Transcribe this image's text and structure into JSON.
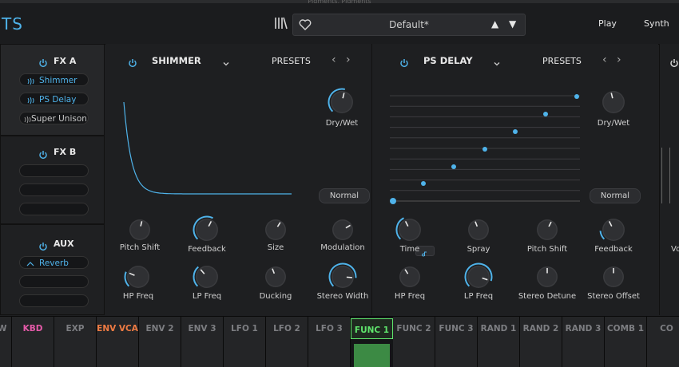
{
  "window_title": "Pigments, Pigments",
  "logo_text": "TS",
  "preset": {
    "name": "Default*",
    "up": "▲",
    "down": "▼"
  },
  "top_buttons": {
    "play": "Play",
    "synth": "Synth"
  },
  "fx_a": {
    "title": "FX A",
    "slots": [
      {
        "label": "Shimmer",
        "active": true
      },
      {
        "label": "PS Delay",
        "active": true
      },
      {
        "label": "Super Unison",
        "active": false
      }
    ]
  },
  "fx_b": {
    "title": "FX B"
  },
  "aux": {
    "title": "AUX",
    "slot": "Reverb"
  },
  "shimmer": {
    "title": "SHIMMER",
    "presets": "PRESETS",
    "prev": "‹",
    "next": "›",
    "mode": "Normal",
    "knobs": [
      "Dry/Wet",
      "Pitch Shift",
      "Feedback",
      "Size",
      "Modulation",
      "HP Freq",
      "LP Freq",
      "Ducking",
      "Stereo Width"
    ]
  },
  "ps_delay": {
    "title": "PS DELAY",
    "presets": "PRESETS",
    "prev": "‹",
    "next": "›",
    "mode": "Normal",
    "knobs": [
      "Dry/Wet",
      "Time",
      "Spray",
      "Pitch Shift",
      "Feedback",
      "HP Freq",
      "LP Freq",
      "Stereo Detune",
      "Stereo Offset"
    ]
  },
  "right_partial_label": "Vo",
  "tabs": [
    {
      "label": "MW",
      "color": "#7d7e82"
    },
    {
      "label": "KBD",
      "color": "#e45aa8"
    },
    {
      "label": "EXP",
      "color": "#7d7e82"
    },
    {
      "label": "ENV VCA",
      "color": "#ef7b43"
    },
    {
      "label": "ENV 2",
      "color": "#7d7e82"
    },
    {
      "label": "ENV 3",
      "color": "#7d7e82"
    },
    {
      "label": "LFO 1",
      "color": "#7d7e82"
    },
    {
      "label": "LFO 2",
      "color": "#7d7e82"
    },
    {
      "label": "LFO 3",
      "color": "#7d7e82"
    },
    {
      "label": "FUNC 1",
      "color": "#5fe56c"
    },
    {
      "label": "FUNC 2",
      "color": "#7d7e82"
    },
    {
      "label": "FUNC 3",
      "color": "#7d7e82"
    },
    {
      "label": "RAND 1",
      "color": "#7d7e82"
    },
    {
      "label": "RAND 2",
      "color": "#7d7e82"
    },
    {
      "label": "RAND 3",
      "color": "#7d7e82"
    },
    {
      "label": "COMB 1",
      "color": "#7d7e82"
    },
    {
      "label": "CO",
      "color": "#7d7e82"
    }
  ],
  "accent_color": "#4fb3ea"
}
